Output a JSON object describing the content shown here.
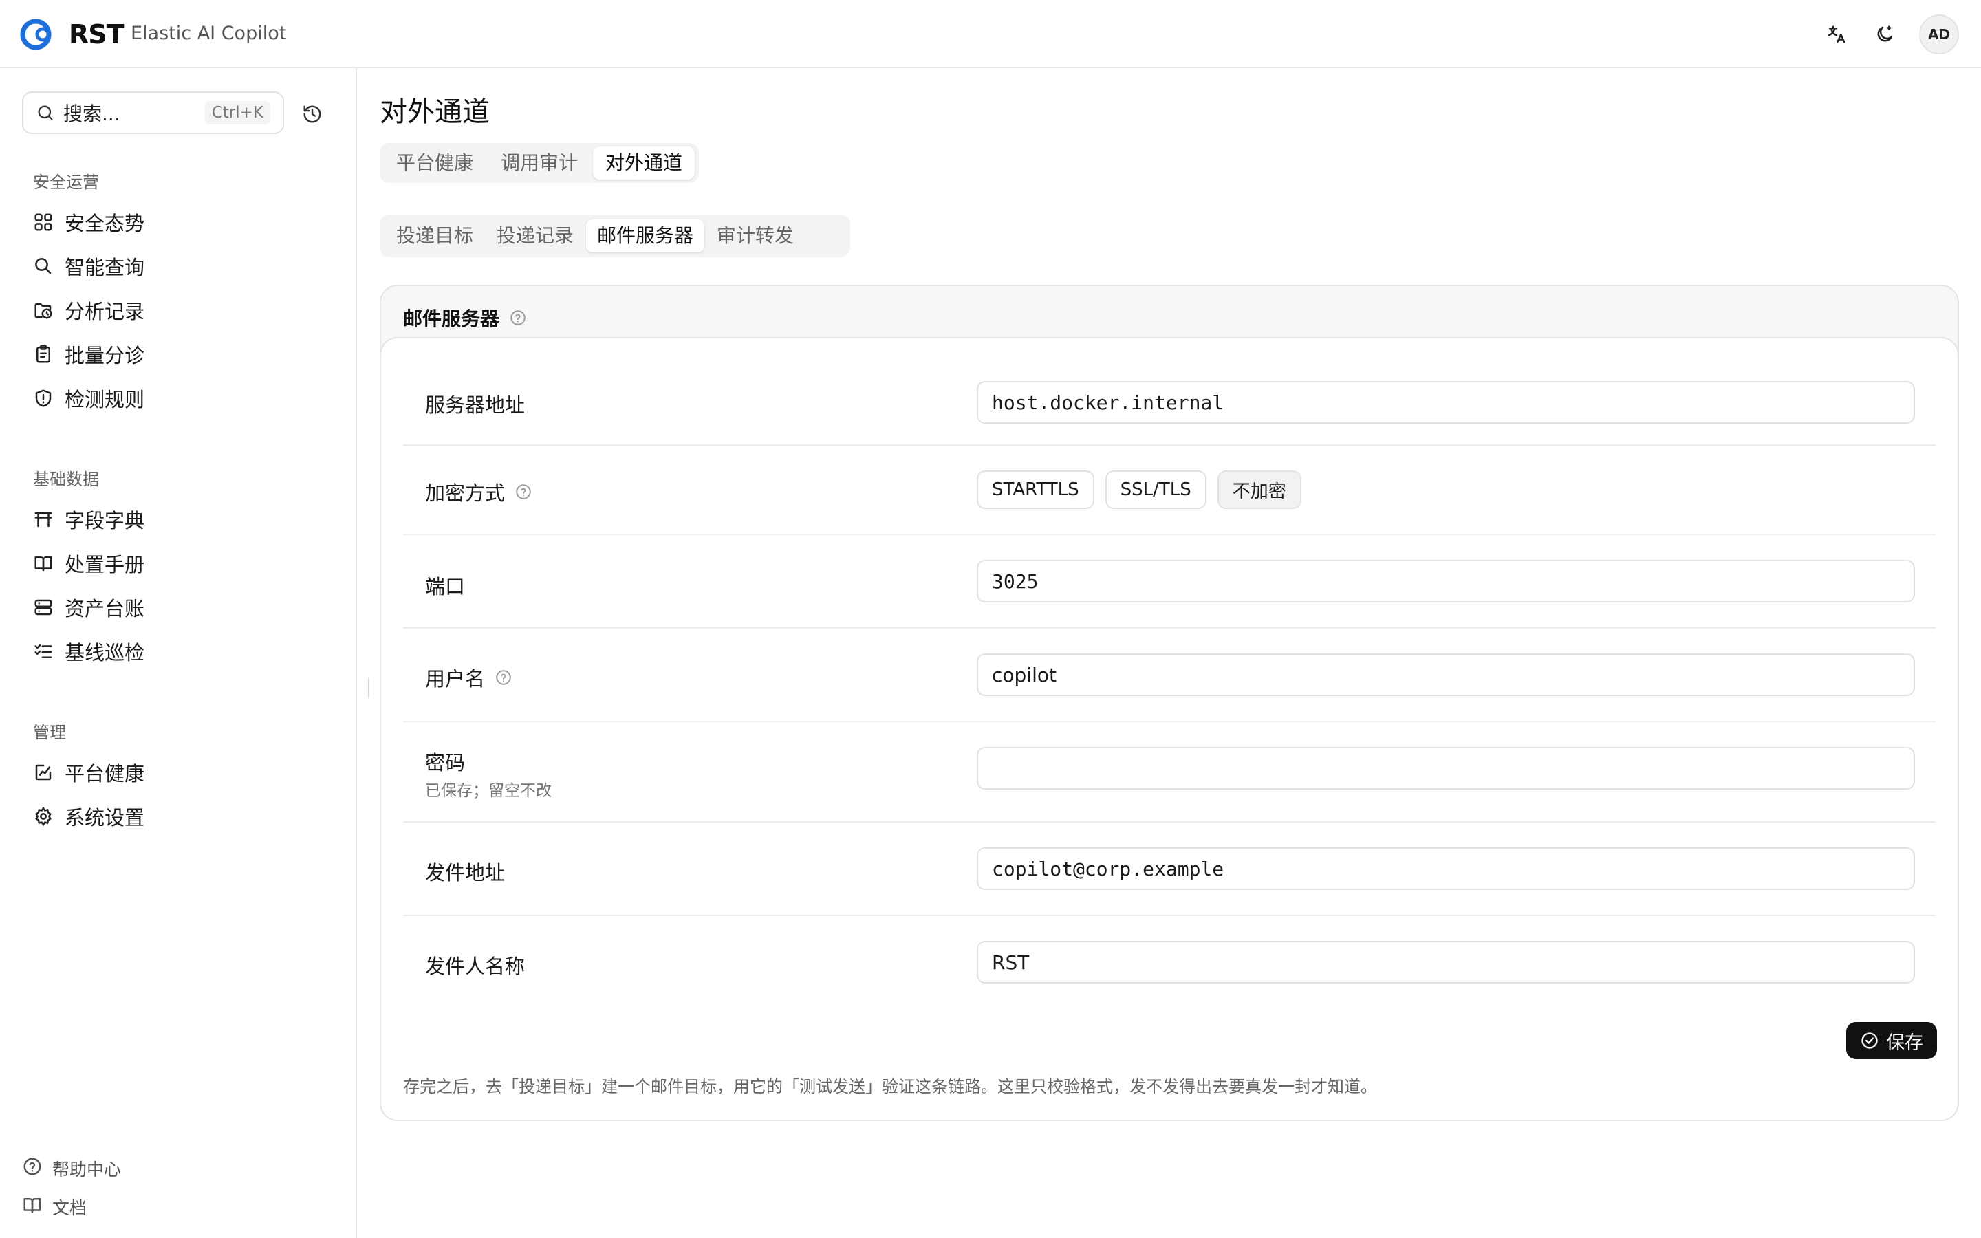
{
  "header": {
    "logo_text": "RST",
    "app_name": "Elastic AI Copilot",
    "avatar_initials": "AD",
    "icons": [
      "translate-icon",
      "theme-toggle-icon"
    ]
  },
  "sidebar": {
    "search_placeholder": "搜索...",
    "search_shortcut": "Ctrl+K",
    "groups": [
      {
        "title": "安全运营",
        "items": [
          "安全态势",
          "智能查询",
          "分析记录",
          "批量分诊",
          "检测规则"
        ]
      },
      {
        "title": "基础数据",
        "items": [
          "字段字典",
          "处置手册",
          "资产台账",
          "基线巡检"
        ]
      },
      {
        "title": "管理",
        "items": [
          "平台健康",
          "系统设置"
        ]
      }
    ],
    "footer": [
      "帮助中心",
      "文档"
    ]
  },
  "main": {
    "title": "对外通道",
    "tabs": [
      "平台健康",
      "调用审计",
      "对外通道"
    ],
    "active_tab": "对外通道",
    "subtabs": [
      "投递目标",
      "投递记录",
      "邮件服务器",
      "审计转发"
    ],
    "active_subtab": "邮件服务器",
    "card_title": "邮件服务器",
    "form": {
      "host_label": "服务器地址",
      "host_value": "host.docker.internal",
      "encryption_label": "加密方式",
      "encryption_options": [
        "STARTTLS",
        "SSL/TLS",
        "不加密"
      ],
      "encryption_selected": "不加密",
      "port_label": "端口",
      "port_value": "3025",
      "username_label": "用户名",
      "username_value": "copilot",
      "password_label": "密码",
      "password_hint": "已保存；留空不改",
      "password_value": "",
      "from_label": "发件地址",
      "from_value": "copilot@corp.example",
      "sender_label": "发件人名称",
      "sender_value": "RST"
    },
    "save_label": "保存",
    "note": "存完之后，去「投递目标」建一个邮件目标，用它的「测试发送」验证这条链路。这里只校验格式，发不发得出去要真发一封才知道。"
  },
  "colors": {
    "brand_blue": "#1e6fd9",
    "text": "#1a1a1a",
    "muted": "#666666",
    "border": "#e2e2e2",
    "button_dark": "#111111"
  }
}
